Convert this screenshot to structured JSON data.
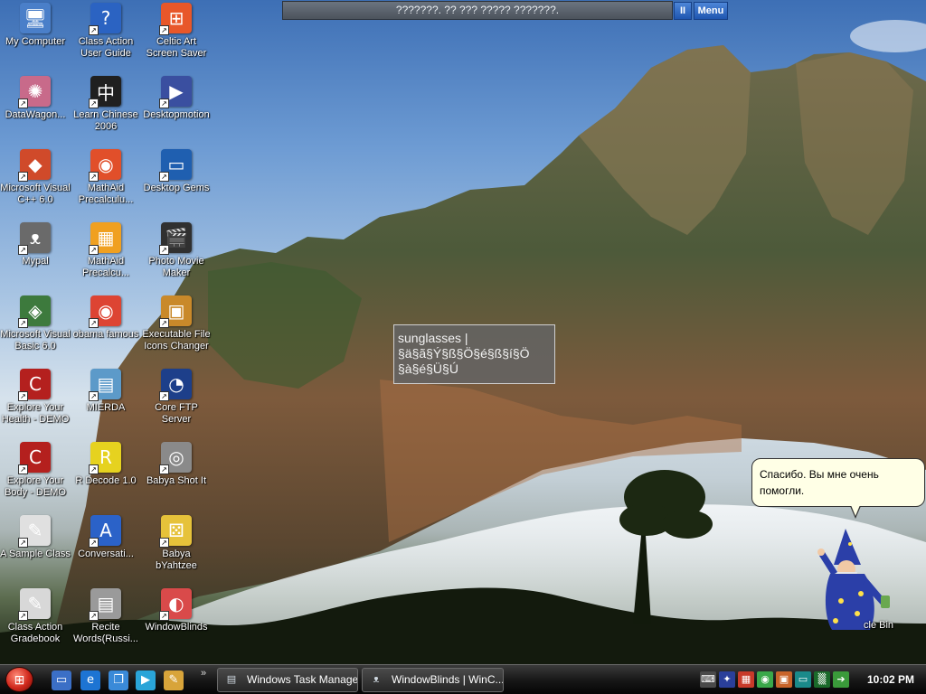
{
  "desktop": {
    "icons": [
      {
        "label": "My Computer",
        "icon": "computer-icon",
        "color": "#4a7fc9",
        "glyph": "🖥",
        "shortcut": false
      },
      {
        "label": "Class Action\nUser Guide",
        "icon": "help-question-icon",
        "color": "#2b63c2",
        "glyph": "?",
        "shortcut": true
      },
      {
        "label": "Celtic Art\nScreen Saver",
        "icon": "windows-flag-icon",
        "color": "#e8572a",
        "glyph": "⊞",
        "shortcut": true
      },
      {
        "label": "DataWagon...",
        "icon": "datawagon-icon",
        "color": "#c86a8a",
        "glyph": "✺",
        "shortcut": true
      },
      {
        "label": "Learn Chinese\n2006",
        "icon": "chinese-character-icon",
        "color": "#202020",
        "glyph": "中",
        "shortcut": true
      },
      {
        "label": "Desktopmotion",
        "icon": "desktopmotion-icon",
        "color": "#3a4fa0",
        "glyph": "▶",
        "shortcut": true
      },
      {
        "label": "Microsoft Visual\nC++ 6.0",
        "icon": "visual-cpp-icon",
        "color": "#d04a2a",
        "glyph": "◆",
        "shortcut": true
      },
      {
        "label": "MathAid\nPrecalculu...",
        "icon": "mathaid-icon",
        "color": "#e14f2a",
        "glyph": "◉",
        "shortcut": true
      },
      {
        "label": "Desktop Gems",
        "icon": "monitor-icon",
        "color": "#1f5fb0",
        "glyph": "▭",
        "shortcut": true
      },
      {
        "label": "Mypal",
        "icon": "raccoon-icon",
        "color": "#6a6a6a",
        "glyph": "ᴥ",
        "shortcut": true
      },
      {
        "label": "MathAid\nPrecalcu...",
        "icon": "mathaid-grid-icon",
        "color": "#f0a020",
        "glyph": "▦",
        "shortcut": true
      },
      {
        "label": "Photo Movie\nMaker",
        "icon": "clapperboard-icon",
        "color": "#303030",
        "glyph": "🎬",
        "shortcut": true
      },
      {
        "label": "Microsoft Visual\nBasic 6.0",
        "icon": "visual-basic-icon",
        "color": "#3d7a3d",
        "glyph": "◈",
        "shortcut": true
      },
      {
        "label": "obama famous",
        "icon": "chrome-icon",
        "color": "#dd4433",
        "glyph": "◉",
        "shortcut": true
      },
      {
        "label": "Executable File\nIcons Changer",
        "icon": "icons-changer-icon",
        "color": "#c9892a",
        "glyph": "▣",
        "shortcut": true
      },
      {
        "label": "Explore Your\nHealth - DEMO",
        "icon": "letter-c-icon",
        "color": "#b4201e",
        "glyph": "C",
        "shortcut": true
      },
      {
        "label": "MIERDA",
        "icon": "document-image-icon",
        "color": "#5c9ac9",
        "glyph": "▤",
        "shortcut": true
      },
      {
        "label": "Core FTP\nServer",
        "icon": "ftp-server-icon",
        "color": "#1d3f8a",
        "glyph": "◔",
        "shortcut": true
      },
      {
        "label": "Explore Your\nBody - DEMO",
        "icon": "letter-c-icon",
        "color": "#b4201e",
        "glyph": "C",
        "shortcut": true
      },
      {
        "label": "R Decode 1.0",
        "icon": "r-decode-icon",
        "color": "#e6d21f",
        "glyph": "R",
        "shortcut": true
      },
      {
        "label": "Babya Shot It",
        "icon": "camera-icon",
        "color": "#8a8a8a",
        "glyph": "◎",
        "shortcut": true
      },
      {
        "label": "A Sample Class",
        "icon": "document-pen-icon",
        "color": "#e0e0e0",
        "glyph": "✎",
        "shortcut": true
      },
      {
        "label": "Conversati...",
        "icon": "conversation-icon",
        "color": "#2b62c8",
        "glyph": "A",
        "shortcut": true
      },
      {
        "label": "Babya\nbYahtzee",
        "icon": "dice-icon",
        "color": "#e6c23a",
        "glyph": "⚄",
        "shortcut": true
      },
      {
        "label": "Class Action\nGradebook",
        "icon": "gradebook-icon",
        "color": "#d8d8d8",
        "glyph": "✎",
        "shortcut": true
      },
      {
        "label": "Recite\nWords(Russi...",
        "icon": "recite-words-icon",
        "color": "#9a9a9a",
        "glyph": "▤",
        "shortcut": true
      },
      {
        "label": "WindowBlinds",
        "icon": "paint-palette-icon",
        "color": "#d94a4a",
        "glyph": "◐",
        "shortcut": true
      }
    ]
  },
  "top_bar": {
    "text": "???????. ?? ??? ????? ???????.",
    "pause_label": "II",
    "menu_label": "Menu"
  },
  "tooltip": {
    "line1": "sunglasses  |",
    "line2": "§ä§ã§Ý§ß§Ö§é§ß§í§Ö",
    "line3": "§à§é§Ü§Ú"
  },
  "assistant": {
    "bubble_text": "Спасибо. Вы мне очень помогли.",
    "recycle_label": "cle Bin"
  },
  "taskbar": {
    "quick_launch": [
      {
        "icon": "desktop-icon",
        "color": "#3b6fc6",
        "glyph": "▭"
      },
      {
        "icon": "internet-explorer-icon",
        "color": "#1d74d3",
        "glyph": "e"
      },
      {
        "icon": "switch-windows-icon",
        "color": "#3a8ad8",
        "glyph": "❐"
      },
      {
        "icon": "media-player-icon",
        "color": "#2aa4d8",
        "glyph": "▶"
      },
      {
        "icon": "paint-icon",
        "color": "#d8a43a",
        "glyph": "✎"
      }
    ],
    "chevron": "»",
    "tasks": [
      {
        "label": "Windows Task Manager",
        "icon": "task-manager-icon",
        "glyph": "▤"
      },
      {
        "label": "WindowBlinds | WinC...",
        "icon": "raccoon-icon",
        "glyph": "ᴥ"
      }
    ],
    "tray": [
      {
        "icon": "keyboard-icon",
        "color": "#4a4a4a",
        "glyph": "⌨"
      },
      {
        "icon": "wizard-icon",
        "color": "#2a3f9a",
        "glyph": "✦"
      },
      {
        "icon": "network-map-icon",
        "color": "#c83a2a",
        "glyph": "▦"
      },
      {
        "icon": "chrome-icon",
        "color": "#3aa84a",
        "glyph": "◉"
      },
      {
        "icon": "photo-icon",
        "color": "#c8642a",
        "glyph": "▣"
      },
      {
        "icon": "monitor-teal-icon",
        "color": "#1a8a8a",
        "glyph": "▭"
      },
      {
        "icon": "matrix-icon",
        "color": "#1a6a2a",
        "glyph": "▒"
      },
      {
        "icon": "safely-remove-icon",
        "color": "#3a9a3a",
        "glyph": "➔"
      }
    ],
    "clock": "10:02 PM"
  }
}
